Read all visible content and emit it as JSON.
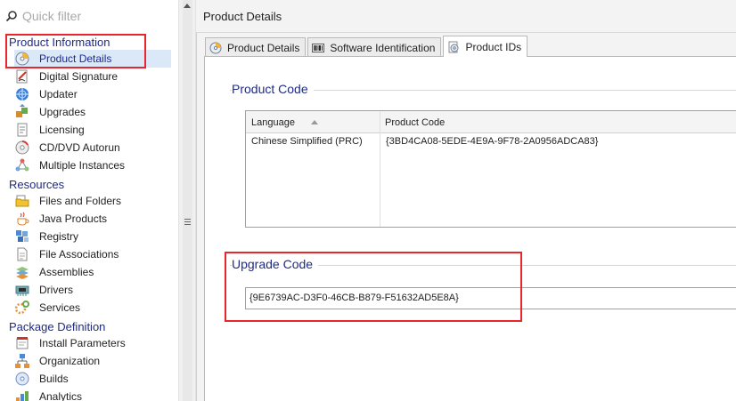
{
  "filter": {
    "placeholder": "Quick filter"
  },
  "tree": {
    "groups": [
      {
        "label": "Product Information"
      },
      {
        "label": "Resources"
      },
      {
        "label": "Package Definition"
      }
    ],
    "product_information": [
      {
        "label": "Product Details",
        "icon": "product-details-icon",
        "selected": true
      },
      {
        "label": "Digital Signature",
        "icon": "digital-signature-icon"
      },
      {
        "label": "Updater",
        "icon": "updater-icon"
      },
      {
        "label": "Upgrades",
        "icon": "upgrades-icon"
      },
      {
        "label": "Licensing",
        "icon": "licensing-icon"
      },
      {
        "label": "CD/DVD Autorun",
        "icon": "cd-dvd-icon"
      },
      {
        "label": "Multiple Instances",
        "icon": "multiple-instances-icon"
      }
    ],
    "resources": [
      {
        "label": "Files and Folders",
        "icon": "files-folders-icon"
      },
      {
        "label": "Java Products",
        "icon": "java-icon"
      },
      {
        "label": "Registry",
        "icon": "registry-icon"
      },
      {
        "label": "File Associations",
        "icon": "file-associations-icon"
      },
      {
        "label": "Assemblies",
        "icon": "assemblies-icon"
      },
      {
        "label": "Drivers",
        "icon": "drivers-icon"
      },
      {
        "label": "Services",
        "icon": "services-icon"
      }
    ],
    "package_definition": [
      {
        "label": "Install Parameters",
        "icon": "install-parameters-icon"
      },
      {
        "label": "Organization",
        "icon": "organization-icon"
      },
      {
        "label": "Builds",
        "icon": "builds-icon"
      },
      {
        "label": "Analytics",
        "icon": "analytics-icon"
      }
    ]
  },
  "pane": {
    "title": "Product Details",
    "tabs": [
      {
        "label": "Product Details",
        "icon": "product-details-tab-icon"
      },
      {
        "label": "Software Identification",
        "icon": "barcode-icon"
      },
      {
        "label": "Product IDs",
        "icon": "product-ids-icon",
        "active": true
      }
    ],
    "product_code": {
      "heading": "Product Code",
      "columns": [
        "Language",
        "Product Code"
      ],
      "rows": [
        {
          "language": "Chinese Simplified (PRC)",
          "code": "{3BD4CA08-5EDE-4E9A-9F78-2A0956ADCA83}"
        }
      ]
    },
    "upgrade_code": {
      "heading": "Upgrade Code",
      "value": "{9E6739AC-D3F0-46CB-B879-F51632AD5E8A}"
    }
  },
  "colors": {
    "highlight": "#e8262b",
    "group_heading": "#1e2a8a",
    "selection": "#dbe8f7"
  }
}
